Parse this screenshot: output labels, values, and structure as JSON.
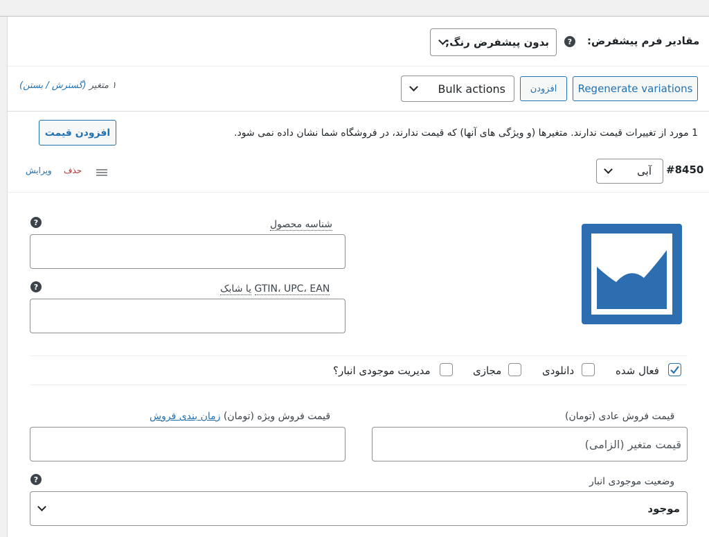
{
  "default_form_values": {
    "label": "مقادیر فرم پیشفرض:",
    "help": "?",
    "selected": "بدون پیشفرض رنگ;"
  },
  "toolbar": {
    "regenerate_label": "Regenerate variations",
    "add_label": "افزودن",
    "bulk_actions_label": "Bulk actions"
  },
  "variations_summary": {
    "count_text": "۱ متغیر",
    "expand_text": "(گسترش / بستن)"
  },
  "notice": {
    "text": "1 مورد از تغییرات قیمت ندارند. متغیرها (و ویژگی های آنها) که قیمت ندارند، در فروشگاه شما نشان داده نمی شود.",
    "button": "افزودن قیمت"
  },
  "variation": {
    "id": "#8450",
    "attribute_selected": "آبی",
    "edit_link": "ویرایش",
    "remove_link": "حذف",
    "sku": {
      "label": "شناسه محصول",
      "value": ""
    },
    "gtin": {
      "label_main": "GTIN، UPC، EAN",
      "label_suffix": "یا شابک",
      "value": ""
    },
    "checkboxes": [
      {
        "label": "فعال شده",
        "checked": true
      },
      {
        "label": "دانلودی",
        "checked": false
      },
      {
        "label": "مجازی",
        "checked": false
      },
      {
        "label": "مدیریت موجودی انبار؟",
        "checked": false
      }
    ],
    "regular_price": {
      "label": "قیمت فروش عادی (تومان)",
      "placeholder": "قیمت متغیر (الزامی)"
    },
    "sale_price": {
      "label": "قیمت فروش ویژه (تومان)",
      "schedule_link": "زمان بندی فروش",
      "value": ""
    },
    "stock_status": {
      "label": "وضعیت موجودی انبار",
      "selected": "موجود"
    }
  },
  "colors": {
    "accent": "#2271b1",
    "danger": "#b32d2e",
    "image_blue": "#2c6eb0"
  },
  "icons": {
    "help": "help-icon",
    "chevron": "chevron-down-icon",
    "menu": "menu-icon",
    "check": "check-icon",
    "image": "image-placeholder-icon"
  }
}
